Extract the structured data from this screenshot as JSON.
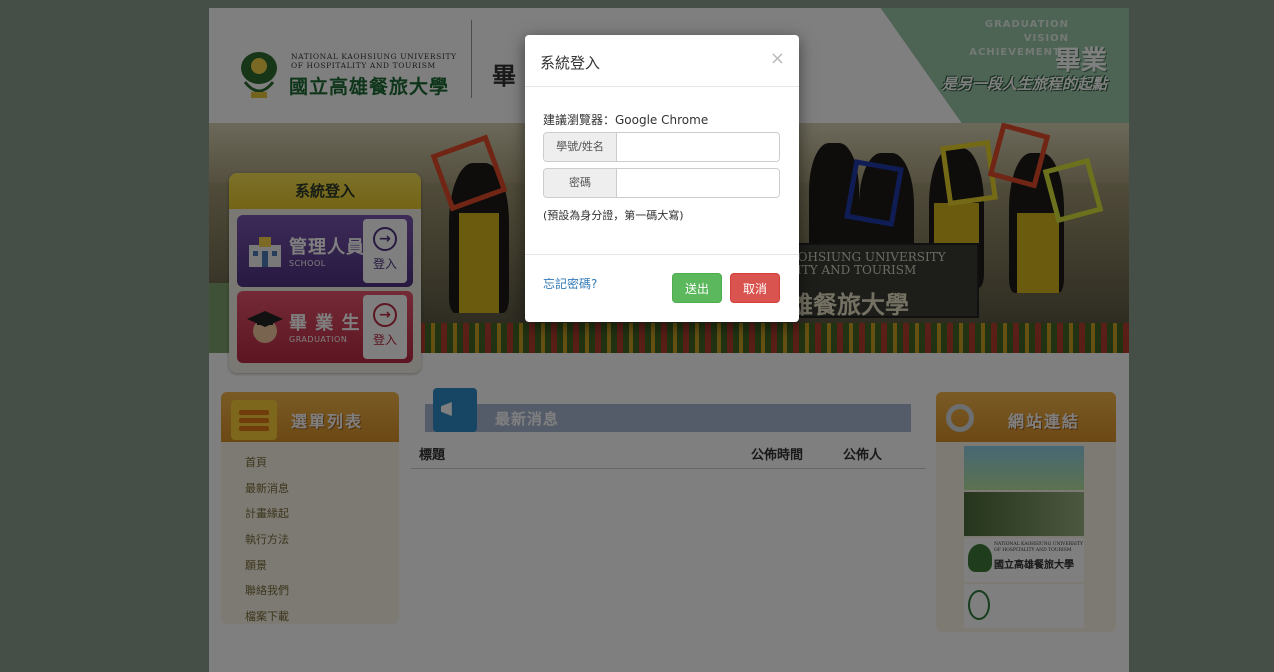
{
  "header": {
    "university_en_line1": "NATIONAL KAOHSIUNG UNIVERSITY",
    "university_en_line2": "OF HOSPITALITY AND TOURISM",
    "university_zh": "國立高雄餐旅大學",
    "title_partial": "畢",
    "tagline_en_1": "GRADUATION",
    "tagline_en_2": "VISION",
    "tagline_en_3": "ACHIEVEMENTS",
    "tagline_big": "畢業",
    "tagline_sub": "是另一段人生旅程的起點"
  },
  "banner": {
    "sign_en_1": "KOHSIUNG UNIVERSITY",
    "sign_en_2": "LITY AND TOURISM",
    "sign_zh": "雄餐旅大學"
  },
  "login_panel": {
    "title": "系統登入",
    "admin_label": "管理人員",
    "admin_sub": "SCHOOL",
    "admin_enter": "登入",
    "grad_label": "畢 業 生",
    "grad_sub": "GRADUATION",
    "grad_enter": "登入"
  },
  "menu": {
    "title": "選單列表",
    "items": [
      "首頁",
      "最新消息",
      "計畫緣起",
      "執行方法",
      "願景",
      "聯絡我們",
      "檔案下載"
    ]
  },
  "news": {
    "title": "最新消息",
    "columns": [
      "標題",
      "公佈時間",
      "公佈人"
    ]
  },
  "links": {
    "title": "網站連結",
    "logo_en_1": "NATIONAL KAOHSIUNG UNIVERSITY",
    "logo_en_2": "OF HOSPITALITY AND TOURISM",
    "logo_zh": "國立高雄餐旅大學"
  },
  "modal": {
    "title": "系統登入",
    "close": "×",
    "browser_note": "建議瀏覽器：Google Chrome",
    "account_label": "學號/姓名",
    "account_value": "",
    "password_label": "密碼",
    "password_value": "",
    "password_hint": "(預設為身分證，第一碼大寫)",
    "forgot": "忘記密碼?",
    "submit": "送出",
    "cancel": "取消"
  }
}
